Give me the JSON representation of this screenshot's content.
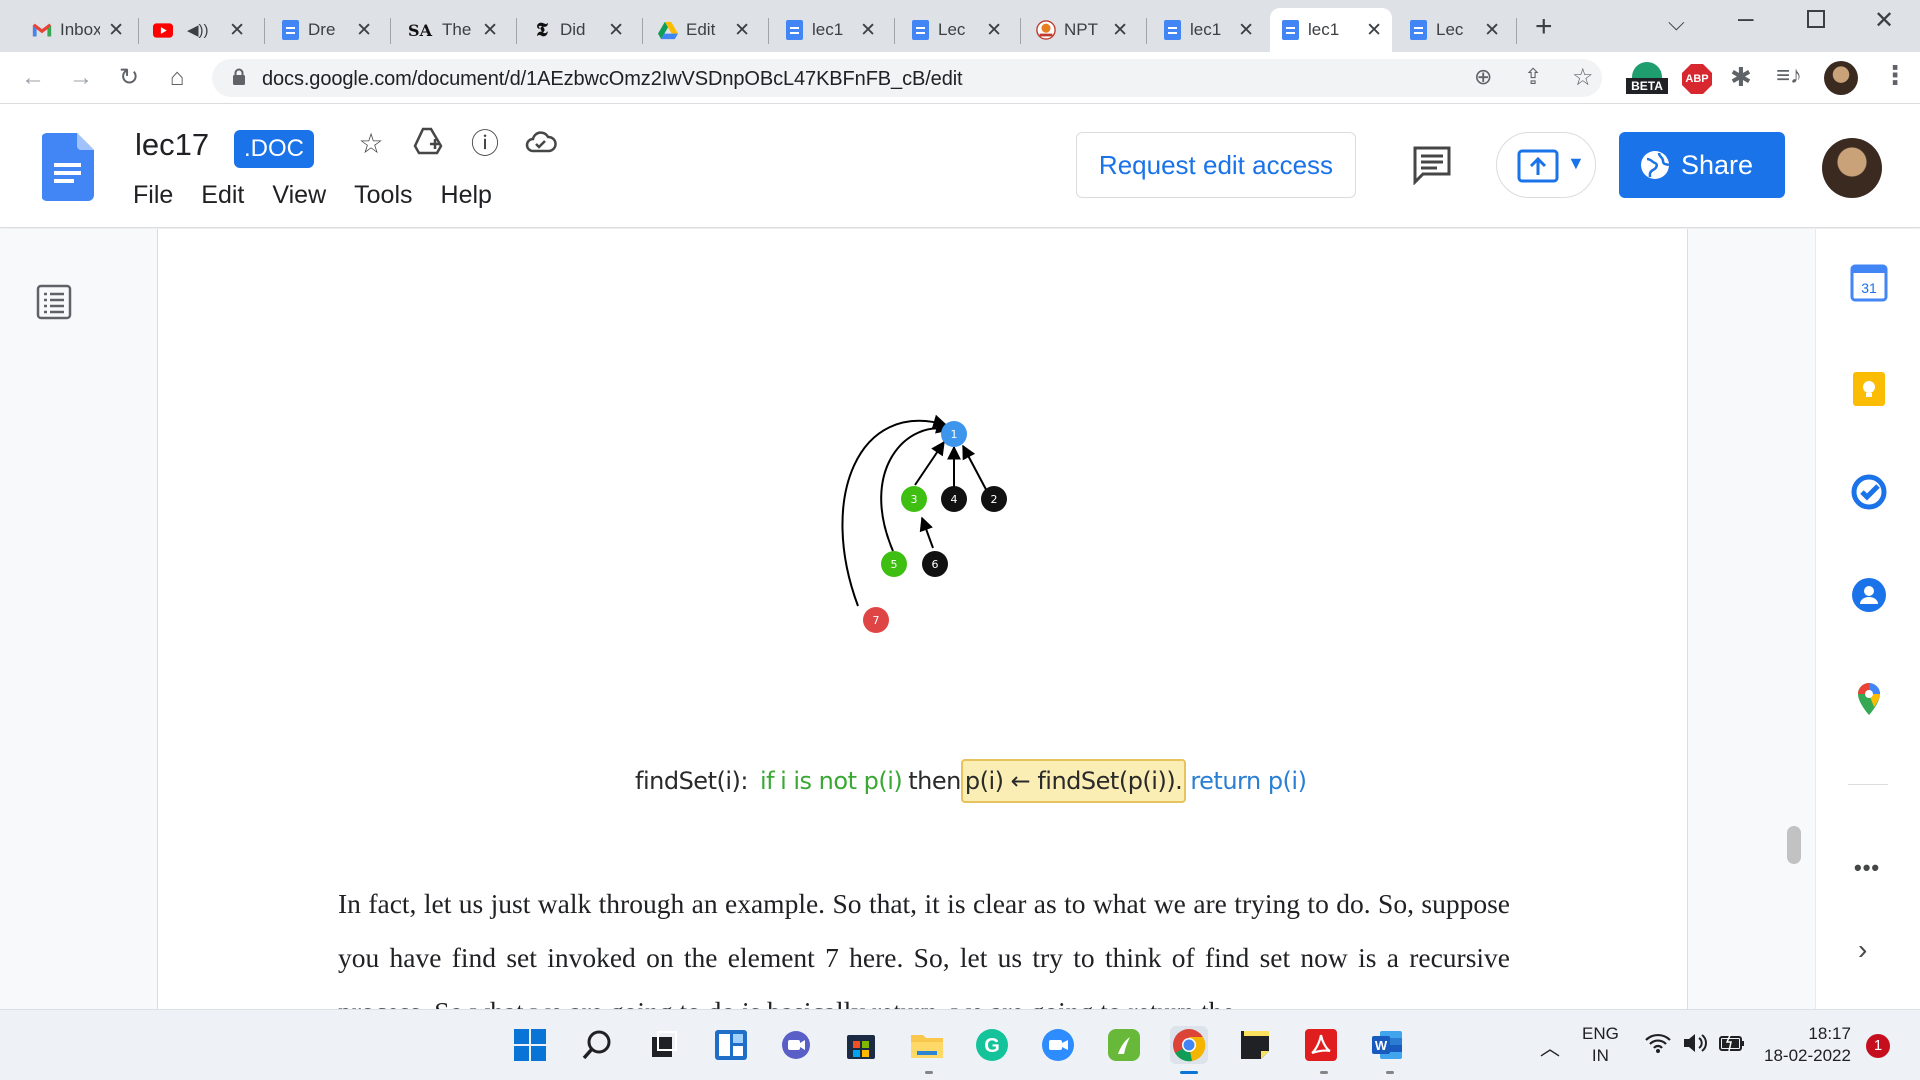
{
  "browser": {
    "tabs": [
      {
        "title": "Inbox",
        "icon": "gmail-icon",
        "active": false
      },
      {
        "title": "",
        "icon": "youtube-icon",
        "active": false,
        "muted": true
      },
      {
        "title": "Dre",
        "icon": "docs-icon",
        "active": false
      },
      {
        "title": "The",
        "icon": "seeking-alpha-icon",
        "active": false
      },
      {
        "title": "Did",
        "icon": "nytimes-icon",
        "active": false
      },
      {
        "title": "Edit",
        "icon": "drive-icon",
        "active": false
      },
      {
        "title": "lec1",
        "icon": "docs-icon",
        "active": false
      },
      {
        "title": "Lec",
        "icon": "docs-icon",
        "active": false
      },
      {
        "title": "NPT",
        "icon": "nptel-icon",
        "active": false
      },
      {
        "title": "lec1",
        "icon": "docs-icon",
        "active": false
      },
      {
        "title": "lec1",
        "icon": "docs-icon",
        "active": true
      },
      {
        "title": "Lec",
        "icon": "docs-icon",
        "active": false
      }
    ],
    "new_tab": "+",
    "url": "docs.google.com/document/d/1AEzbwcOmz2IwVSDnpOBcL47KBFnFB_cB/edit",
    "beta_label": "BETA",
    "abp_label": "ABP"
  },
  "docs": {
    "title": "lec17",
    "badge": ".DOC",
    "menu": [
      "File",
      "Edit",
      "View",
      "Tools",
      "Help"
    ],
    "request_edit": "Request edit access",
    "share": "Share"
  },
  "figure": {
    "nodes": [
      "1",
      "3",
      "4",
      "2",
      "5",
      "6",
      "7"
    ],
    "node_colors": {
      "1": "#3e95ec",
      "3": "#3fbf12",
      "5": "#3fbf12",
      "7": "#e04545",
      "4": "#111111",
      "2": "#111111",
      "6": "#111111"
    },
    "formula": {
      "prefix": "findSet(i):",
      "if_part": "if",
      "cond": "i is not p(i)",
      "then": "then",
      "assign": "p(i) ← findSet(p(i)).",
      "ret": "return p(i)"
    }
  },
  "paragraph": "In fact, let us just walk through an example. So that, it is clear as to what we are trying to do. So, suppose you have find set invoked on the element 7 here. So, let us try to think of find set now is a recursive process. So what we are going to do is basically return, we are going to return the",
  "side_panel": {
    "calendar_day": "31"
  },
  "taskbar": {
    "lang_line1": "ENG",
    "lang_line2": "IN",
    "time": "18:17",
    "date": "18-02-2022",
    "notifications": "1"
  }
}
